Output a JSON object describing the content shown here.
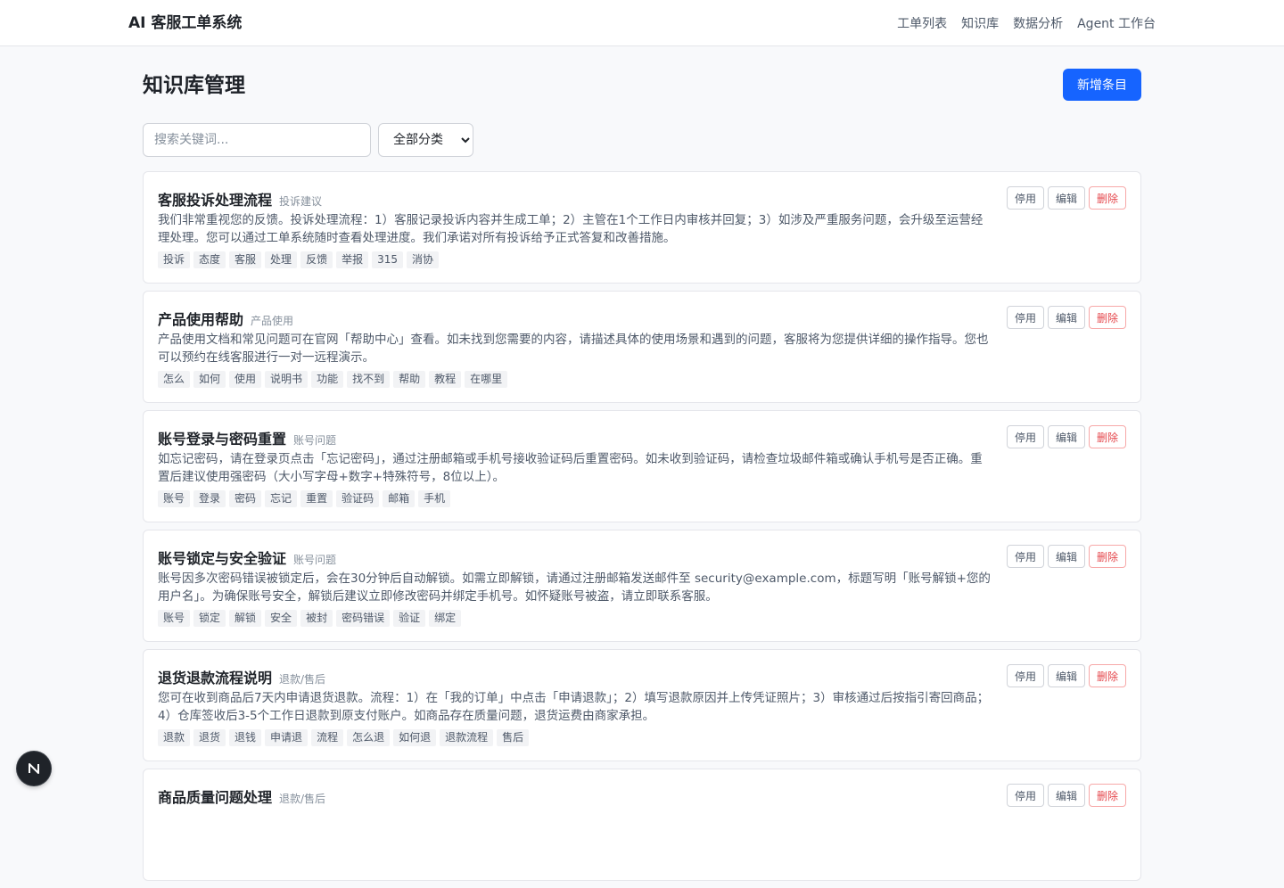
{
  "header": {
    "brand": "AI 客服工单系统",
    "nav": [
      "工单列表",
      "知识库",
      "数据分析",
      "Agent 工作台"
    ]
  },
  "page": {
    "title": "知识库管理",
    "add_button": "新增条目"
  },
  "filters": {
    "search_placeholder": "搜索关键词...",
    "category_selected": "全部分类"
  },
  "actions": {
    "disable": "停用",
    "edit": "编辑",
    "delete": "删除"
  },
  "entries": [
    {
      "title": "客服投诉处理流程",
      "category": "投诉建议",
      "content": "我们非常重视您的反馈。投诉处理流程：1）客服记录投诉内容并生成工单；2）主管在1个工作日内审核并回复；3）如涉及严重服务问题，会升级至运营经理处理。您可以通过工单系统随时查看处理进度。我们承诺对所有投诉给予正式答复和改善措施。",
      "tags": [
        "投诉",
        "态度",
        "客服",
        "处理",
        "反馈",
        "举报",
        "315",
        "消协"
      ]
    },
    {
      "title": "产品使用帮助",
      "category": "产品使用",
      "content": "产品使用文档和常见问题可在官网「帮助中心」查看。如未找到您需要的内容，请描述具体的使用场景和遇到的问题，客服将为您提供详细的操作指导。您也可以预约在线客服进行一对一远程演示。",
      "tags": [
        "怎么",
        "如何",
        "使用",
        "说明书",
        "功能",
        "找不到",
        "帮助",
        "教程",
        "在哪里"
      ]
    },
    {
      "title": "账号登录与密码重置",
      "category": "账号问题",
      "content": "如忘记密码，请在登录页点击「忘记密码」，通过注册邮箱或手机号接收验证码后重置密码。如未收到验证码，请检查垃圾邮件箱或确认手机号是否正确。重置后建议使用强密码（大小写字母+数字+特殊符号，8位以上）。",
      "tags": [
        "账号",
        "登录",
        "密码",
        "忘记",
        "重置",
        "验证码",
        "邮箱",
        "手机"
      ]
    },
    {
      "title": "账号锁定与安全验证",
      "category": "账号问题",
      "content": "账号因多次密码错误被锁定后，会在30分钟后自动解锁。如需立即解锁，请通过注册邮箱发送邮件至 security@example.com，标题写明「账号解锁+您的用户名」。为确保账号安全，解锁后建议立即修改密码并绑定手机号。如怀疑账号被盗，请立即联系客服。",
      "tags": [
        "账号",
        "锁定",
        "解锁",
        "安全",
        "被封",
        "密码错误",
        "验证",
        "绑定"
      ]
    },
    {
      "title": "退货退款流程说明",
      "category": "退款/售后",
      "content": "您可在收到商品后7天内申请退货退款。流程：1）在「我的订单」中点击「申请退款」；2）填写退款原因并上传凭证照片；3）审核通过后按指引寄回商品；4）仓库签收后3-5个工作日退款到原支付账户。如商品存在质量问题，退货运费由商家承担。",
      "tags": [
        "退款",
        "退货",
        "退钱",
        "申请退",
        "流程",
        "怎么退",
        "如何退",
        "退款流程",
        "售后"
      ]
    },
    {
      "title": "商品质量问题处理",
      "category": "退款/售后",
      "content": "",
      "tags": []
    }
  ],
  "fab": {
    "label": "N"
  },
  "colors": {
    "primary": "#1664ff",
    "danger": "#e5484d"
  }
}
